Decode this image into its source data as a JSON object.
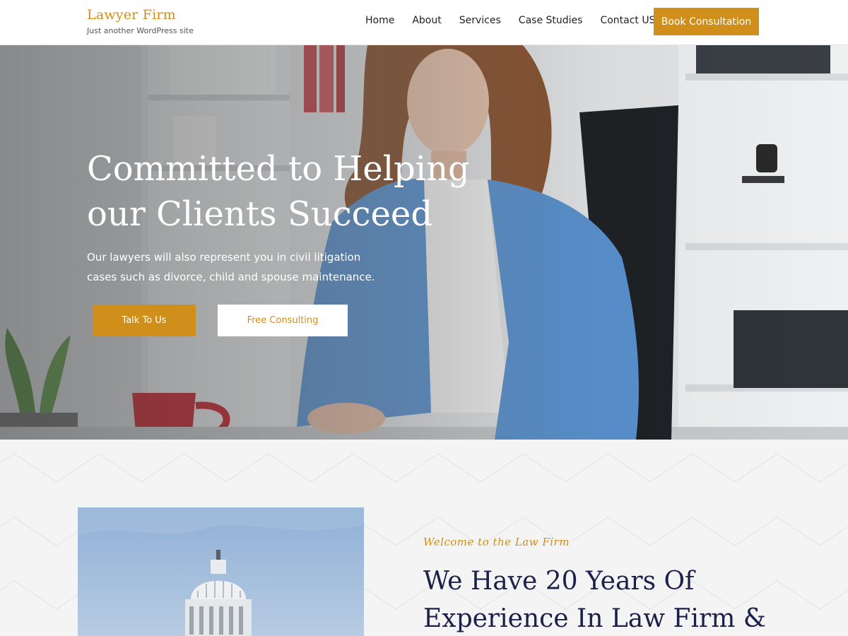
{
  "header": {
    "site_title": "Lawyer Firm",
    "tagline": "Just another WordPress site",
    "nav": [
      "Home",
      "About",
      "Services",
      "Case Studies",
      "Contact US"
    ],
    "cta_label": "Book Consultation"
  },
  "hero": {
    "title": "Committed to Helping our Clients Succeed",
    "text": "Our lawyers will also represent you in civil litigation cases such as divorce, child and spouse maintenance.",
    "primary_button": "Talk To Us",
    "secondary_button": "Free Consulting"
  },
  "about": {
    "eyebrow": "Welcome to the Law Firm",
    "title": "We Have 20 Years Of Experience In Law Firm &"
  },
  "colors": {
    "accent": "#d08f1b",
    "heading_dark": "#1c1f4a"
  }
}
